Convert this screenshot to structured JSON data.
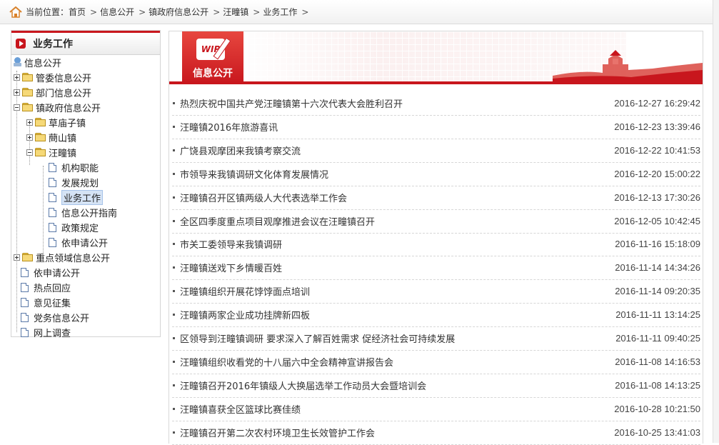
{
  "breadcrumb": {
    "prefix": "当前位置：",
    "items": [
      "首页",
      "信息公开",
      "镇政府信息公开",
      "汪疃镇",
      "业务工作"
    ],
    "separator": ">"
  },
  "sidebar": {
    "title": "业务工作",
    "root": "信息公开",
    "nodes": [
      {
        "label": "管委信息公开",
        "type": "folder",
        "level": 1,
        "expander": "plus"
      },
      {
        "label": "部门信息公开",
        "type": "folder",
        "level": 1,
        "expander": "plus"
      },
      {
        "label": "镇政府信息公开",
        "type": "folder",
        "level": 1,
        "expander": "minus"
      },
      {
        "label": "草庙子镇",
        "type": "folder",
        "level": 2,
        "expander": "plus"
      },
      {
        "label": "蔄山镇",
        "type": "folder",
        "level": 2,
        "expander": "plus"
      },
      {
        "label": "汪疃镇",
        "type": "folder-open",
        "level": 2,
        "expander": "minus"
      },
      {
        "label": "机构职能",
        "type": "doc",
        "level": 3
      },
      {
        "label": "发展规划",
        "type": "doc",
        "level": 3
      },
      {
        "label": "业务工作",
        "type": "doc",
        "level": 3,
        "selected": true
      },
      {
        "label": "信息公开指南",
        "type": "doc",
        "level": 3
      },
      {
        "label": "政策规定",
        "type": "doc",
        "level": 3
      },
      {
        "label": "依申请公开",
        "type": "doc",
        "level": 3
      },
      {
        "label": "重点领域信息公开",
        "type": "folder",
        "level": 1,
        "expander": "plus"
      },
      {
        "label": "依申请公开",
        "type": "doc",
        "level": 1
      },
      {
        "label": "热点回应",
        "type": "doc",
        "level": 1
      },
      {
        "label": "意见征集",
        "type": "doc",
        "level": 1
      },
      {
        "label": "党务信息公开",
        "type": "doc",
        "level": 1
      },
      {
        "label": "网上调查",
        "type": "doc",
        "level": 1
      }
    ]
  },
  "banner": {
    "badge_text": "WIP",
    "label": "信息公开"
  },
  "articles": [
    {
      "title": "热烈庆祝中国共产党汪疃镇第十六次代表大会胜利召开",
      "date": "2016-12-27 16:29:42"
    },
    {
      "title": "汪疃镇2016年旅游喜讯",
      "date": "2016-12-23 13:39:46"
    },
    {
      "title": "广饶县观摩团来我镇考察交流",
      "date": "2016-12-22 10:41:53"
    },
    {
      "title": "市领导来我镇调研文化体育发展情况",
      "date": "2016-12-20 15:00:22"
    },
    {
      "title": "汪疃镇召开区镇两级人大代表选举工作会",
      "date": "2016-12-13 17:30:26"
    },
    {
      "title": "全区四季度重点项目观摩推进会议在汪疃镇召开",
      "date": "2016-12-05 10:42:45"
    },
    {
      "title": "市关工委领导来我镇调研",
      "date": "2016-11-16 15:18:09"
    },
    {
      "title": "汪疃镇送戏下乡情暖百姓",
      "date": "2016-11-14 14:34:26"
    },
    {
      "title": "汪疃镇组织开展花饽饽面点培训",
      "date": "2016-11-14 09:20:35"
    },
    {
      "title": "汪疃镇两家企业成功挂牌新四板",
      "date": "2016-11-11 13:14:25"
    },
    {
      "title": "区领导到汪疃镇调研 要求深入了解百姓需求 促经济社会可持续发展",
      "date": "2016-11-11 09:40:25"
    },
    {
      "title": "汪疃镇组织收看党的十八届六中全会精神宣讲报告会",
      "date": "2016-11-08 14:16:53"
    },
    {
      "title": "汪疃镇召开2016年镇级人大换届选举工作动员大会暨培训会",
      "date": "2016-11-08 14:13:25"
    },
    {
      "title": "汪疃镇喜获全区篮球比赛佳绩",
      "date": "2016-10-28 10:21:50"
    },
    {
      "title": "汪疃镇召开第二次农村环境卫生长效管护工作会",
      "date": "2016-10-25 13:41:03"
    }
  ]
}
